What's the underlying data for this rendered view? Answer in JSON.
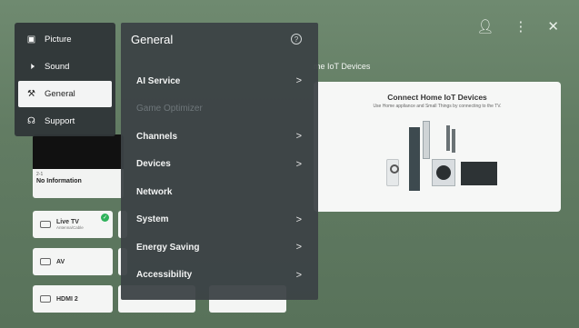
{
  "background": {
    "section_title": "me IoT Devices",
    "iot_card": {
      "title": "Connect Home IoT Devices",
      "subtitle": "Use Home appliance and Small Things by connecting to the TV."
    },
    "tv_preview": {
      "channel": "2-1",
      "info": "No Information"
    },
    "tiles": [
      {
        "label": "Live TV",
        "sub": "Antenna/Cable"
      },
      {
        "label": "AV"
      },
      {
        "label": "HDMI 2"
      }
    ]
  },
  "left_menu": {
    "items": [
      {
        "label": "Picture",
        "icon": "picture-icon"
      },
      {
        "label": "Sound",
        "icon": "speaker-icon"
      },
      {
        "label": "General",
        "icon": "wrench-icon",
        "active": true
      },
      {
        "label": "Support",
        "icon": "headset-icon"
      }
    ]
  },
  "settings": {
    "title": "General",
    "help_icon": "?",
    "items": [
      {
        "label": "AI Service",
        "chevron": ">"
      },
      {
        "label": "Game Optimizer",
        "disabled": true
      },
      {
        "label": "Channels",
        "chevron": ">"
      },
      {
        "label": "Devices",
        "chevron": ">"
      },
      {
        "label": "Network"
      },
      {
        "label": "System",
        "chevron": ">"
      },
      {
        "label": "Energy Saving",
        "chevron": ">"
      },
      {
        "label": "Accessibility",
        "chevron": ">"
      }
    ]
  },
  "topbar": {
    "account_icon": "person-icon",
    "more_icon": "more-vertical-icon",
    "close_icon": "close-icon"
  }
}
